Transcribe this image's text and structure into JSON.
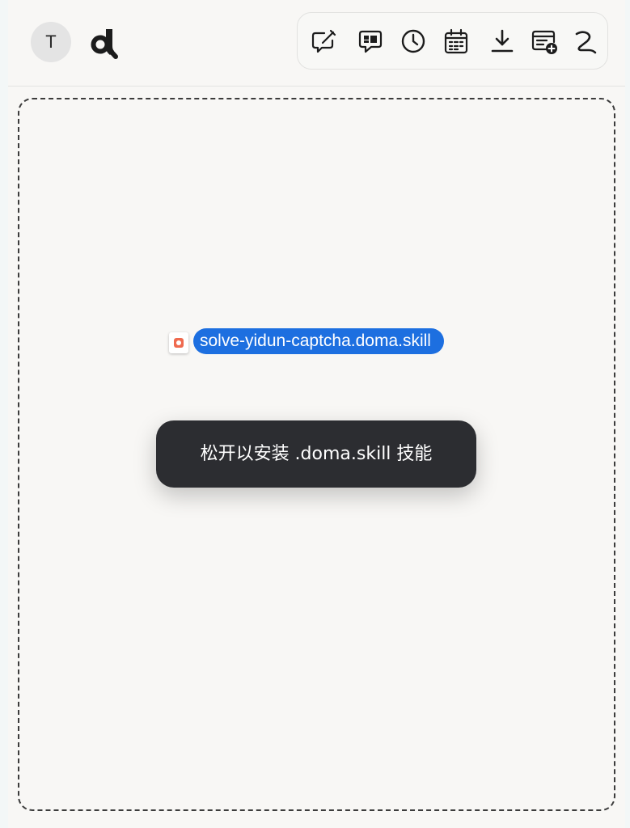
{
  "header": {
    "avatar_initial": "T",
    "logo_icon": "doma-logo-icon",
    "toolbar": [
      {
        "icon": "new-chat-icon"
      },
      {
        "icon": "chat-layout-icon"
      },
      {
        "icon": "history-clock-icon"
      },
      {
        "icon": "calendar-icon"
      },
      {
        "icon": "download-icon"
      },
      {
        "icon": "add-document-icon"
      },
      {
        "icon": "path-route-icon"
      }
    ]
  },
  "dropzone": {
    "dragged_file_name": "solve-yidun-captcha.doma.skill",
    "drop_hint": "松开以安装 .doma.skill 技能"
  },
  "colors": {
    "selection_blue": "#1d6fe0",
    "toast_background": "#2c2d31",
    "file_badge": "#ef6a4f"
  }
}
